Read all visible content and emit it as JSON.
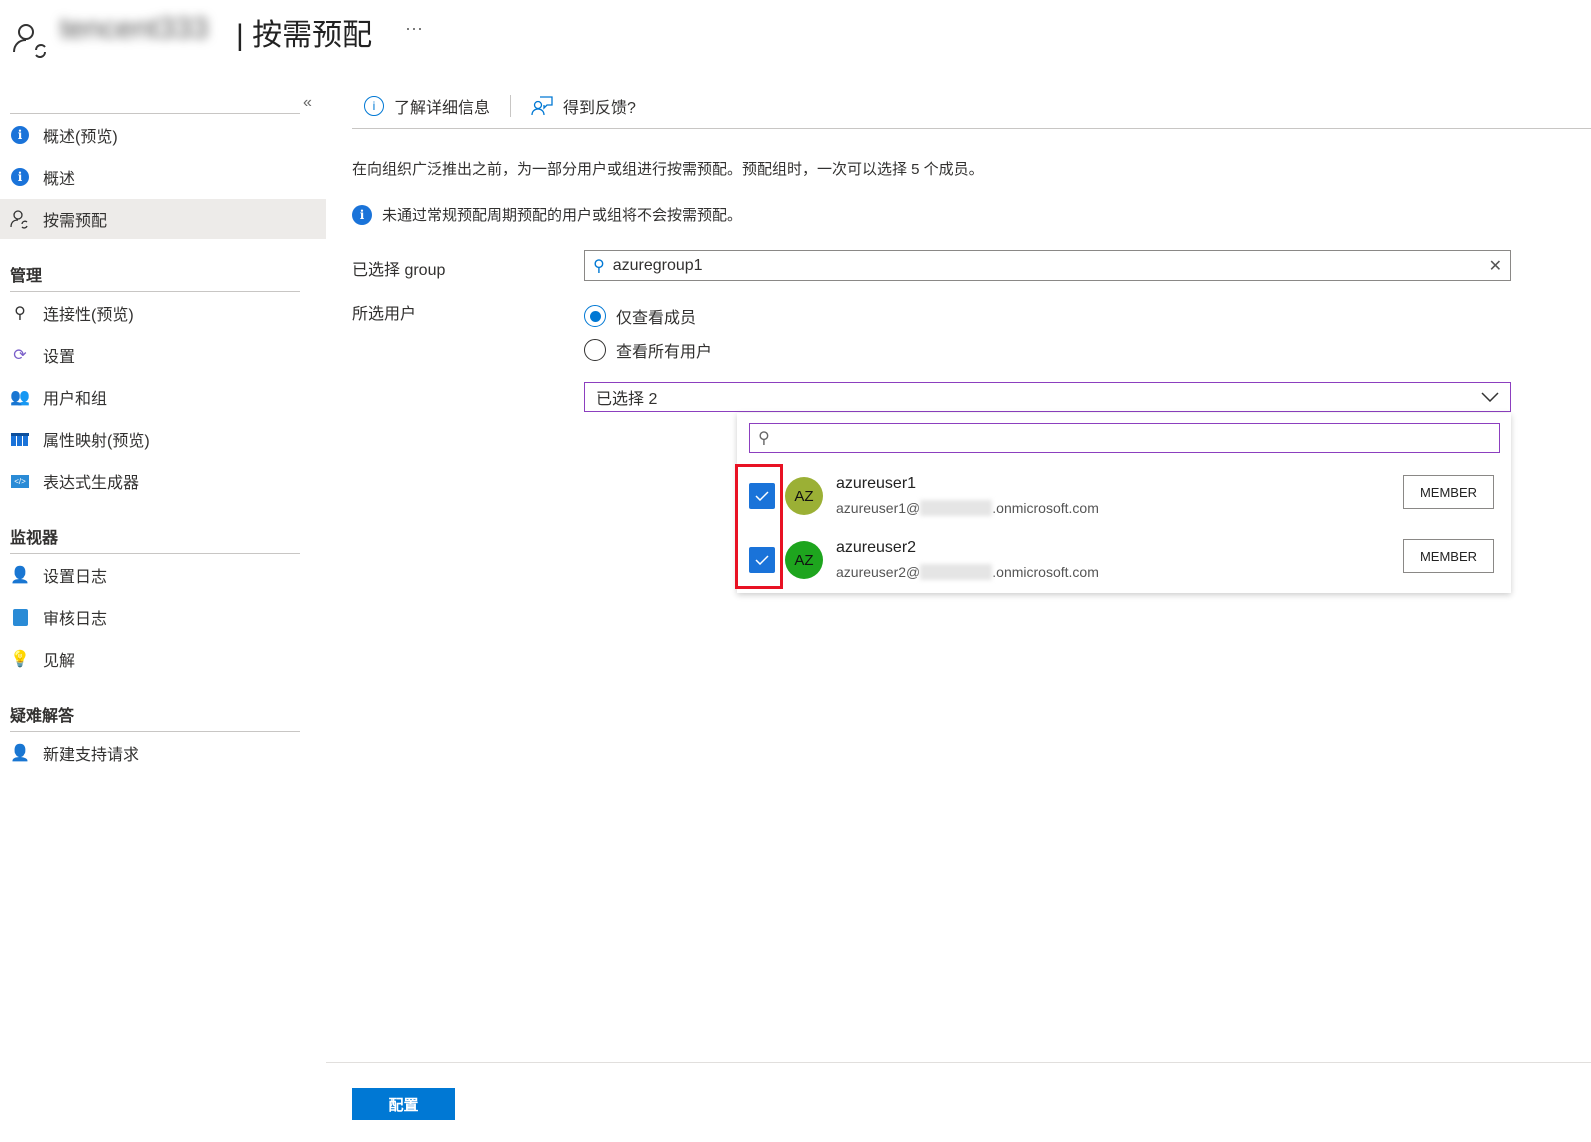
{
  "header": {
    "tenant": "tencent333",
    "title": "| 按需预配",
    "more": "···"
  },
  "sidebar": {
    "collapse": "«",
    "items": [
      {
        "label": "概述(预览)"
      },
      {
        "label": "概述"
      },
      {
        "label": "按需预配"
      }
    ],
    "sections": [
      {
        "title": "管理",
        "items": [
          "连接性(预览)",
          "设置",
          "用户和组",
          "属性映射(预览)",
          "表达式生成器"
        ]
      },
      {
        "title": "监视器",
        "items": [
          "设置日志",
          "审核日志",
          "见解"
        ]
      },
      {
        "title": "疑难解答",
        "items": [
          "新建支持请求"
        ]
      }
    ]
  },
  "toolbar": {
    "learn": "了解详细信息",
    "feedback": "得到反馈?"
  },
  "main": {
    "description": "在向组织广泛推出之前，为一部分用户或组进行按需预配。预配组时，一次可以选择 5 个成员。",
    "notice": "未通过常规预配周期预配的用户或组将不会按需预配。",
    "group_label": "已选择 group",
    "group_value": "azuregroup1",
    "users_label": "所选用户",
    "radio_members": "仅查看成员",
    "radio_all": "查看所有用户",
    "dropdown_value": "已选择 2",
    "users": [
      {
        "name": "azureuser1",
        "email_prefix": "azureuser1@",
        "email_suffix": ".onmicrosoft.com",
        "initials": "AZ",
        "role": "MEMBER",
        "color": "#9bb035",
        "checked": true
      },
      {
        "name": "azureuser2",
        "email_prefix": "azureuser2@",
        "email_suffix": ".onmicrosoft.com",
        "initials": "AZ",
        "role": "MEMBER",
        "color": "#1ea51e",
        "checked": true
      }
    ],
    "apply": "配置"
  }
}
